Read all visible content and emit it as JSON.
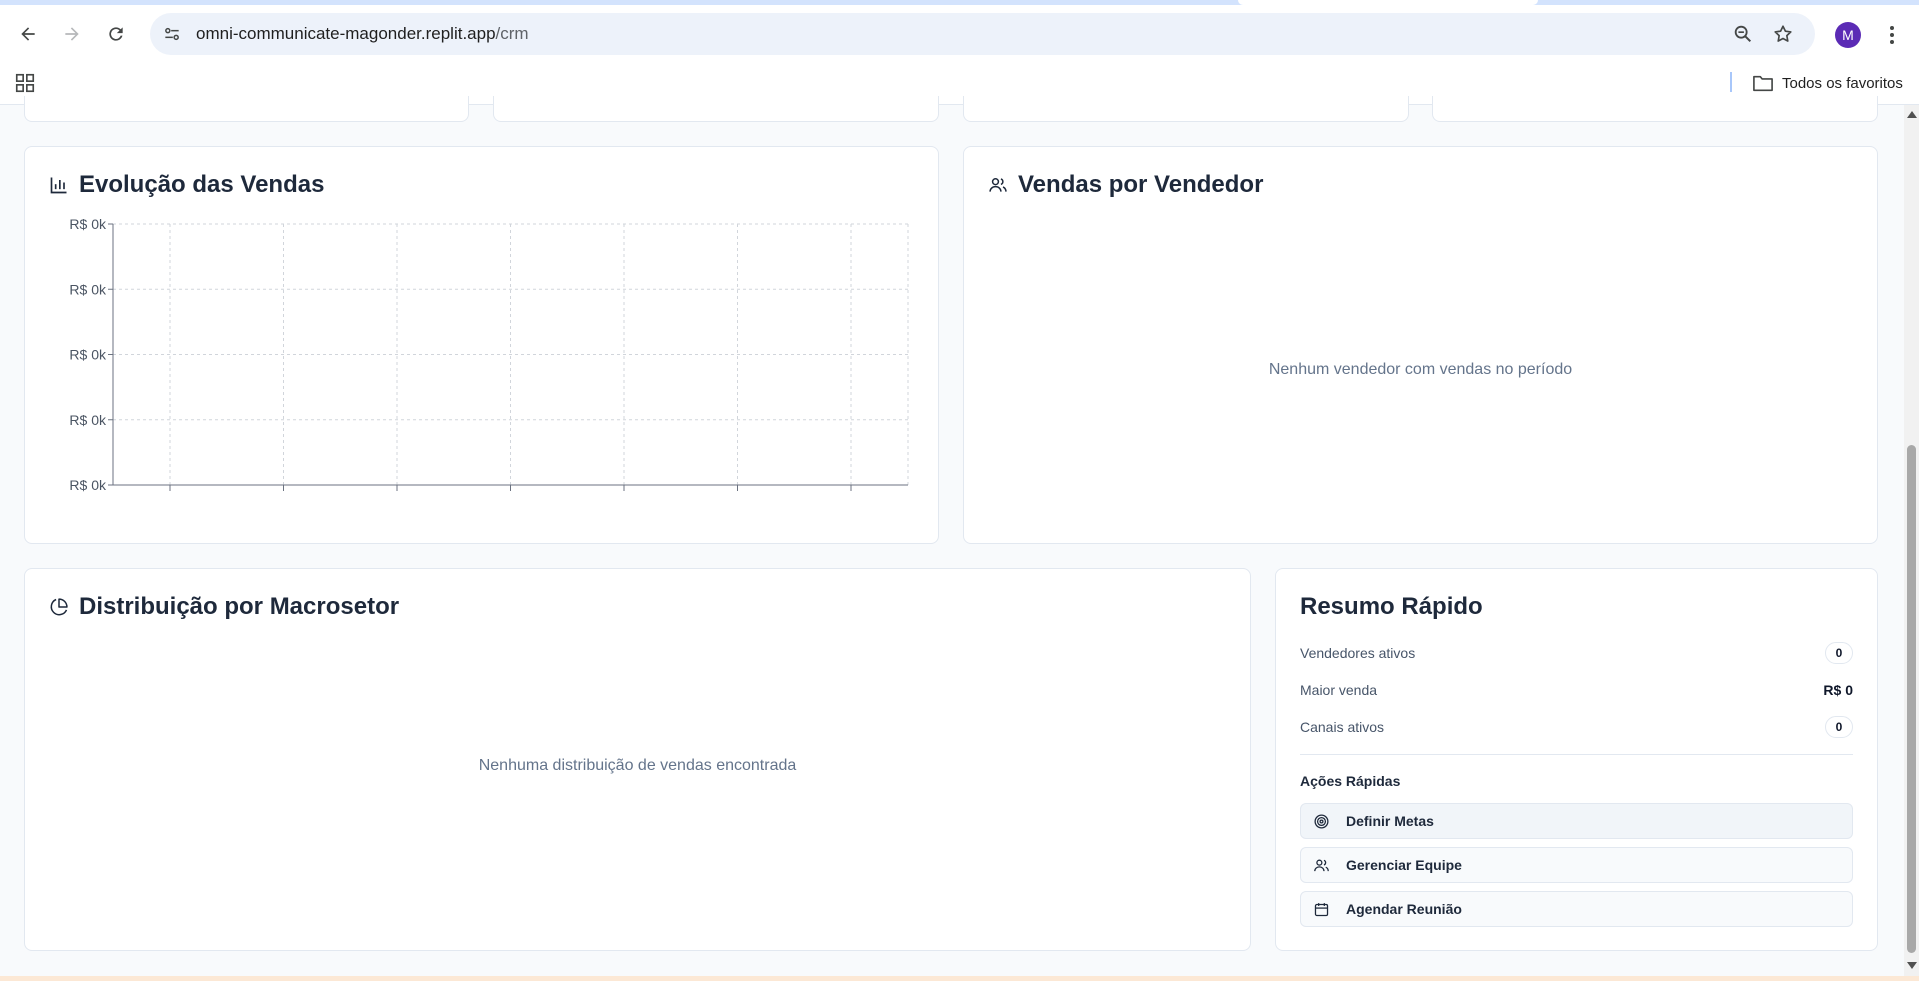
{
  "browser": {
    "url_host": "omni-communicate-magonder.replit.app",
    "url_path": "/crm",
    "avatar_letter": "M",
    "bookmarks_folder": "Todos os favoritos"
  },
  "sales_chart": {
    "title": "Evolução das Vendas",
    "icon": "bar-chart-icon"
  },
  "chart_data": {
    "type": "line",
    "title": "Evolução das Vendas",
    "xlabel": "",
    "ylabel": "",
    "y_tick_labels": [
      "R$ 0k",
      "R$ 0k",
      "R$ 0k",
      "R$ 0k",
      "R$ 0k"
    ],
    "x": [],
    "series": [],
    "grid": true,
    "x_tick_count": 7
  },
  "sellers": {
    "title": "Vendas por Vendedor",
    "icon": "users-icon",
    "empty_message": "Nenhum vendedor com vendas no período"
  },
  "macrosetor": {
    "title": "Distribuição por Macrosetor",
    "icon": "pie-chart-icon",
    "empty_message": "Nenhuma distribuição de vendas encontrada"
  },
  "resumo": {
    "title": "Resumo Rápido",
    "rows": [
      {
        "label": "Vendedores ativos",
        "value": "0"
      },
      {
        "label": "Maior venda",
        "value": "R$ 0"
      },
      {
        "label": "Canais ativos",
        "value": "0"
      }
    ],
    "actions_title": "Ações Rápidas",
    "actions": [
      {
        "label": "Definir Metas",
        "icon": "target-icon"
      },
      {
        "label": "Gerenciar Equipe",
        "icon": "users-icon"
      },
      {
        "label": "Agendar Reunião",
        "icon": "calendar-icon"
      }
    ]
  },
  "colors": {
    "accent_avatar": "#5b2bb5",
    "card_border": "#e2e8f0",
    "muted_text": "#64748b",
    "heading": "#1e293b"
  }
}
